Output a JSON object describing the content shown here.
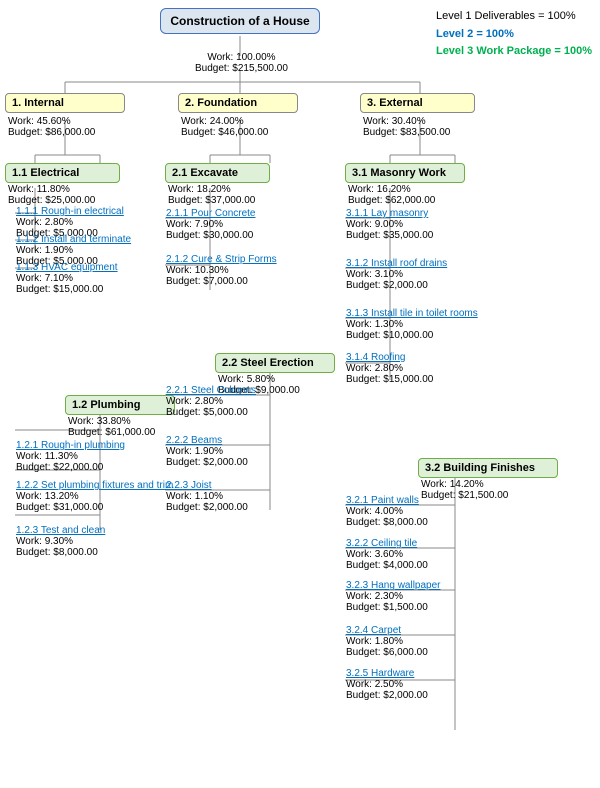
{
  "legend": {
    "line1": "Level 1 Deliverables = 100%",
    "line2": "Level 2 = 100%",
    "line3": "Level 3 Work Package = 100%"
  },
  "root": {
    "title": "Construction of a House",
    "work": "100.00%",
    "budget": "$215,500.00"
  },
  "l1": [
    {
      "id": "internal",
      "label": "1. Internal",
      "work": "45.60%",
      "budget": "$86,000.00",
      "children": [
        {
          "id": "electrical",
          "label": "1.1 Electrical",
          "work": "11.80%",
          "budget": "$25,000.00",
          "items": [
            {
              "label": "1.1.1  Rough-in electrical",
              "work": "2.80%",
              "budget": "$5,000.00"
            },
            {
              "label": "1.1.2  Install and terminate",
              "work": "1.90%",
              "budget": "$5,000.00"
            },
            {
              "label": "1.1.3  HVAC equipment",
              "work": "7.10%",
              "budget": "$15,000.00"
            }
          ]
        },
        {
          "id": "plumbing",
          "label": "1.2 Plumbing",
          "work": "33.80%",
          "budget": "$61,000.00",
          "items": [
            {
              "label": "1.2.1  Rough-in plumbing",
              "work": "11.30%",
              "budget": "$22,000.00"
            },
            {
              "label": "1.2.2  Set plumbing fixtures and trim",
              "work": "13.20%",
              "budget": "$31,000.00"
            },
            {
              "label": "1.2.3  Test and clean",
              "work": "9.30%",
              "budget": "$8,000.00"
            }
          ]
        }
      ]
    },
    {
      "id": "foundation",
      "label": "2. Foundation",
      "work": "24.00%",
      "budget": "$46,000.00",
      "children": [
        {
          "id": "excavate",
          "label": "2.1 Excavate",
          "work": "18.20%",
          "budget": "$37,000.00",
          "items": [
            {
              "label": "2.1.1  Pour Concrete",
              "work": "7.90%",
              "budget": "$30,000.00"
            },
            {
              "label": "2.1.2  Cure & Strip Forms",
              "work": "10.30%",
              "budget": "$7,000.00"
            }
          ]
        },
        {
          "id": "steel",
          "label": "2.2 Steel Erection",
          "work": "5.80%",
          "budget": "$9,000.00",
          "items": [
            {
              "label": "2.2.1  Steel Columns",
              "work": "2.80%",
              "budget": "$5,000.00"
            },
            {
              "label": "2.2.2  Beams",
              "work": "1.90%",
              "budget": "$2,000.00"
            },
            {
              "label": "2.2.3  Joist",
              "work": "1.10%",
              "budget": "$2,000.00"
            }
          ]
        }
      ]
    },
    {
      "id": "external",
      "label": "3. External",
      "work": "30.40%",
      "budget": "$83,500.00",
      "children": [
        {
          "id": "masonry",
          "label": "3.1 Masonry Work",
          "work": "16.20%",
          "budget": "$62,000.00",
          "items": [
            {
              "label": "3.1.1  Lay masonry",
              "work": "9.00%",
              "budget": "$35,000.00"
            },
            {
              "label": "3.1.2  Install roof drains",
              "work": "3.10%",
              "budget": "$2,000.00"
            },
            {
              "label": "3.1.3  Install tile in toilet rooms",
              "work": "1.30%",
              "budget": "$10,000.00"
            },
            {
              "label": "3.1.4  Roofing",
              "work": "2.80%",
              "budget": "$15,000.00"
            }
          ]
        },
        {
          "id": "finishes",
          "label": "3.2 Building Finishes",
          "work": "14.20%",
          "budget": "$21,500.00",
          "items": [
            {
              "label": "3.2.1  Paint walls",
              "work": "4.00%",
              "budget": "$8,000.00"
            },
            {
              "label": "3.2.2  Ceiling tile",
              "work": "3.60%",
              "budget": "$4,000.00"
            },
            {
              "label": "3.2.3  Hang wallpaper",
              "work": "2.30%",
              "budget": "$1,500.00"
            },
            {
              "label": "3.2.4  Carpet",
              "work": "1.80%",
              "budget": "$6,000.00"
            },
            {
              "label": "3.2.5  Hardware",
              "work": "2.50%",
              "budget": "$2,000.00"
            }
          ]
        }
      ]
    }
  ]
}
